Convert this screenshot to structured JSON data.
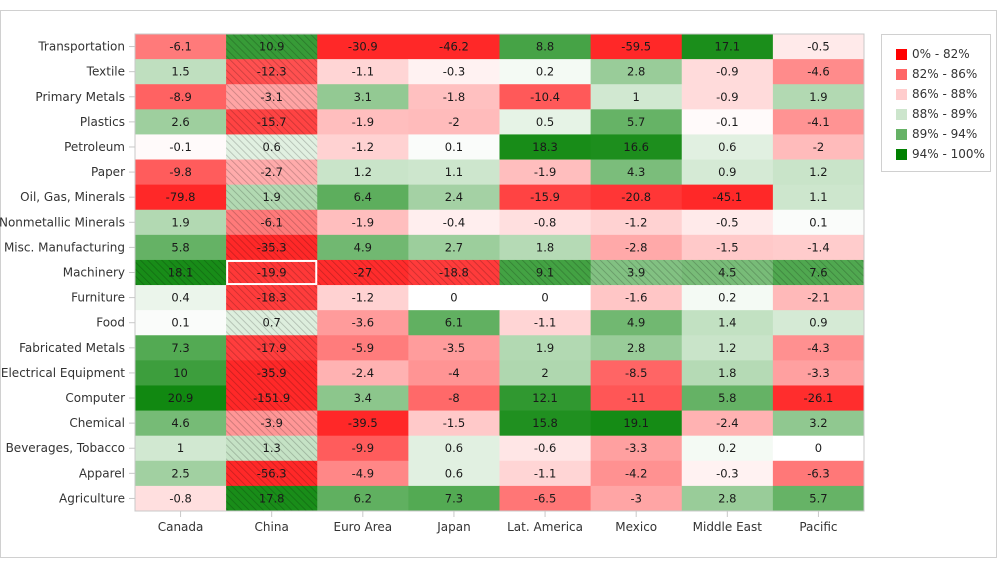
{
  "chart_data": {
    "type": "heatmap",
    "title": "",
    "xlabel": "",
    "ylabel": "",
    "x_categories": [
      "Canada",
      "China",
      "Euro Area",
      "Japan",
      "Lat. America",
      "Mexico",
      "Middle East",
      "Pacific"
    ],
    "y_categories": [
      "Transportation",
      "Textile",
      "Primary Metals",
      "Plastics",
      "Petroleum",
      "Paper",
      "Oil, Gas, Minerals",
      "Nonmetallic Minerals",
      "Misc. Manufacturing",
      "Machinery",
      "Furniture",
      "Food",
      "Fabricated Metals",
      "Electrical Equipment",
      "Computer",
      "Chemical",
      "Beverages, Tobacco",
      "Apparel",
      "Agriculture"
    ],
    "values": [
      [
        -6.1,
        10.9,
        -30.9,
        -46.2,
        8.8,
        -59.5,
        17.1,
        -0.5
      ],
      [
        1.5,
        -12.3,
        -1.1,
        -0.3,
        0.2,
        2.8,
        -0.9,
        -4.6
      ],
      [
        -8.9,
        -3.1,
        3.1,
        -1.8,
        -10.4,
        1,
        -0.9,
        1.9
      ],
      [
        2.6,
        -15.7,
        -1.9,
        -2,
        0.5,
        5.7,
        -0.1,
        -4.1
      ],
      [
        -0.1,
        0.6,
        -1.2,
        0.1,
        18.3,
        16.6,
        0.6,
        -2
      ],
      [
        -9.8,
        -2.7,
        1.2,
        1.1,
        -1.9,
        4.3,
        0.9,
        1.2
      ],
      [
        -79.8,
        1.9,
        6.4,
        2.4,
        -15.9,
        -20.8,
        -45.1,
        1.1
      ],
      [
        1.9,
        -6.1,
        -1.9,
        -0.4,
        -0.8,
        -1.2,
        -0.5,
        0.1
      ],
      [
        5.8,
        -35.3,
        4.9,
        2.7,
        1.8,
        -2.8,
        -1.5,
        -1.4
      ],
      [
        18.1,
        -19.9,
        -27,
        -18.8,
        9.1,
        3.9,
        4.5,
        7.6
      ],
      [
        0.4,
        -18.3,
        -1.2,
        0,
        0,
        -1.6,
        0.2,
        -2.1
      ],
      [
        0.1,
        0.7,
        -3.6,
        6.1,
        -1.1,
        4.9,
        1.4,
        0.9
      ],
      [
        7.3,
        -17.9,
        -5.9,
        -3.5,
        1.9,
        2.8,
        1.2,
        -4.3
      ],
      [
        10,
        -35.9,
        -2.4,
        -4,
        2,
        -8.5,
        1.8,
        -3.3
      ],
      [
        20.9,
        -151.9,
        3.4,
        -8,
        12.1,
        -11,
        5.8,
        -26.1
      ],
      [
        4.6,
        -3.9,
        -39.5,
        -1.5,
        15.8,
        19.1,
        -2.4,
        3.2
      ],
      [
        1,
        1.3,
        -9.9,
        0.6,
        -0.6,
        -3.3,
        0.2,
        0
      ],
      [
        2.5,
        -56.3,
        -4.9,
        0.6,
        -1.1,
        -4.2,
        -0.3,
        -6.3
      ],
      [
        -0.8,
        17.8,
        6.2,
        7.3,
        -6.5,
        -3,
        2.8,
        5.7
      ]
    ],
    "highlighted_column": "China",
    "highlighted_row": "Machinery",
    "selected_cell": {
      "row": "Machinery",
      "column": "China"
    },
    "legend": {
      "placement": "right",
      "items": [
        {
          "label": "0% - 82%",
          "color": "#ff0000"
        },
        {
          "label": "82% - 86%",
          "color": "#ff6666"
        },
        {
          "label": "86% - 88%",
          "color": "#ffcccc"
        },
        {
          "label": "88% - 89%",
          "color": "#cce5cc"
        },
        {
          "label": "89% - 94%",
          "color": "#66b266"
        },
        {
          "label": "94% - 100%",
          "color": "#008000"
        }
      ]
    },
    "grid": false
  },
  "colors": {
    "negative": "#ff0000",
    "positive": "#008000",
    "neutral": "#ffffff",
    "text": "#1a1a1a",
    "axis": "#c8c8c8"
  }
}
